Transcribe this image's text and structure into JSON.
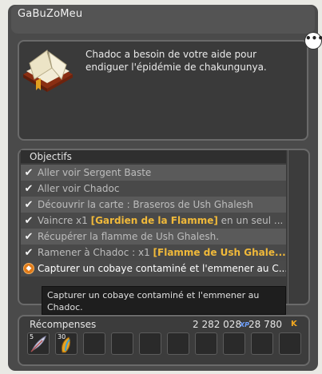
{
  "window": {
    "title": "GaBuZoMeu"
  },
  "quest": {
    "description": "Chadoc a besoin de votre aide pour endiguer l'épidémie de chakungunya.",
    "book_icon": "quest-book-icon",
    "chat_icon": "speech-bubble-icon"
  },
  "objectives": {
    "title": "Objectifs",
    "items": [
      {
        "status": "done",
        "text": "Aller voir Sergent Baste",
        "highlight": "",
        "suffix": ""
      },
      {
        "status": "done",
        "text": "Aller voir Chadoc",
        "highlight": "",
        "suffix": ""
      },
      {
        "status": "done",
        "text": "Découvrir la carte : Braseros de Ush Ghalesh",
        "highlight": "",
        "suffix": ""
      },
      {
        "status": "done",
        "text": "Vaincre x1 ",
        "highlight": "[Gardien de la Flamme]",
        "suffix": " en un seul ..."
      },
      {
        "status": "done",
        "text": "Récupérer la flamme de Ush Ghalesh.",
        "highlight": "",
        "suffix": ""
      },
      {
        "status": "done",
        "text": "Ramener à Chadoc : x1 ",
        "highlight": "[Flamme de Ush Ghale...",
        "suffix": ""
      },
      {
        "status": "current",
        "text": "Capturer un cobaye contaminé et l'emmener au C...",
        "highlight": "",
        "suffix": ""
      }
    ]
  },
  "tooltip": {
    "text": "Capturer un cobaye contaminé et l'emmener au Chadoc."
  },
  "rewards": {
    "title": "Récompenses",
    "xp": "2 282 028",
    "xp_label": "XP",
    "kamas": "28 780",
    "kama_symbol": "K",
    "slots": [
      {
        "qty": "5",
        "icon": "feather-quill-icon"
      },
      {
        "qty": "30",
        "icon": "wing-item-icon"
      },
      {
        "qty": "",
        "icon": ""
      },
      {
        "qty": "",
        "icon": ""
      },
      {
        "qty": "",
        "icon": ""
      },
      {
        "qty": "",
        "icon": ""
      },
      {
        "qty": "",
        "icon": ""
      },
      {
        "qty": "",
        "icon": ""
      },
      {
        "qty": "",
        "icon": ""
      },
      {
        "qty": "",
        "icon": ""
      }
    ]
  },
  "colors": {
    "highlight": "#f0b93a",
    "current_marker": "#e07a18",
    "xp": "#6ea0ff",
    "kama": "#f3a820"
  }
}
